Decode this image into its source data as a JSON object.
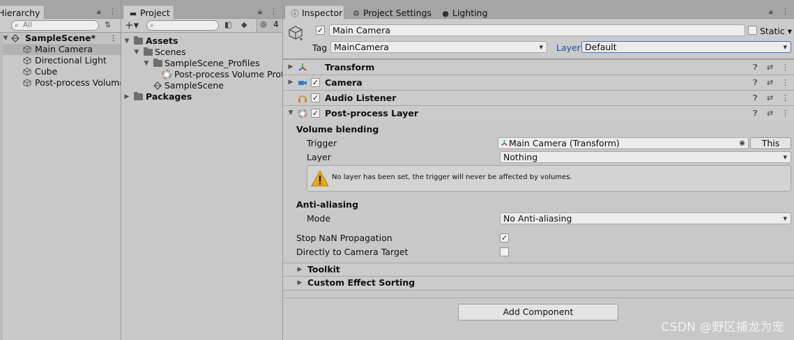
{
  "hierarchy": {
    "tab_label": "Hierarchy",
    "search_placeholder": "All",
    "scene": "SampleScene*",
    "items": [
      "Main Camera",
      "Directional Light",
      "Cube",
      "Post-process Volume"
    ]
  },
  "project": {
    "tab_label": "Project",
    "hidden_count": "4",
    "assets": "Assets",
    "scenes": "Scenes",
    "profiles": "SampleScene_Profiles",
    "profile_asset": "Post-process Volume Profil",
    "scene_asset": "SampleScene",
    "packages": "Packages"
  },
  "inspector": {
    "tabs": [
      "Inspector",
      "Project Settings",
      "Lighting"
    ],
    "object_name": "Main Camera",
    "static_label": "Static",
    "tag_label": "Tag",
    "tag_value": "MainCamera",
    "layer_label": "Layer",
    "layer_value": "Default",
    "components": [
      "Transform",
      "Camera",
      "Audio Listener",
      "Post-process Layer"
    ],
    "volume_blending": "Volume blending",
    "trigger_label": "Trigger",
    "trigger_value": "Main Camera (Transform)",
    "this_button": "This",
    "layer_prop_label": "Layer",
    "layer_prop_value": "Nothing",
    "warning": "No layer has been set, the trigger will never be affected by volumes.",
    "anti_aliasing": "Anti-aliasing",
    "mode_label": "Mode",
    "mode_value": "No Anti-aliasing",
    "stop_nan": "Stop NaN Propagation",
    "direct_target": "Directly to Camera Target",
    "toolkit": "Toolkit",
    "custom_sorting": "Custom Effect Sorting",
    "add_component": "Add Component"
  },
  "watermark": "CSDN @野区捕龙为宠"
}
